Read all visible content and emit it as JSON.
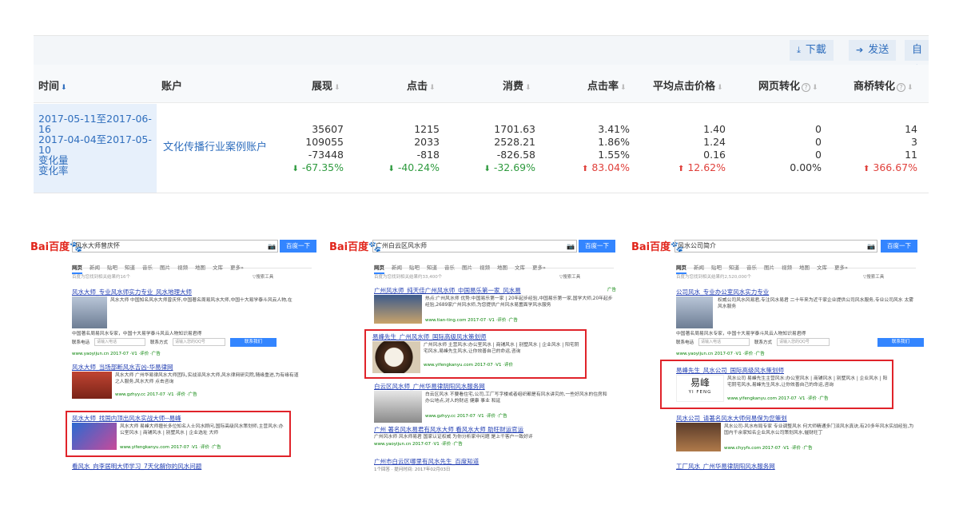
{
  "toolbar": {
    "download_label": "下載",
    "send_label": "发送",
    "extra_label": "自定"
  },
  "table": {
    "headers": {
      "time": "时间",
      "account": "账户",
      "impressions": "展现",
      "clicks": "点击",
      "cost": "消费",
      "ctr": "点击率",
      "avg_cpc": "平均点击价格",
      "page_conv": "网页转化",
      "bridge_conv": "商桥转化"
    },
    "left_rows": [
      "2017-05-11至2017-06-",
      "16",
      "2017-04-04至2017-05-",
      "10",
      "变化量",
      "变化率"
    ],
    "account_name": "文化传播行业案例账户",
    "columns": {
      "impressions": {
        "v1": "35607",
        "v2": "109055",
        "delta": "-73448",
        "rate": "-67.35%",
        "dir": "down"
      },
      "clicks": {
        "v1": "1215",
        "v2": "2033",
        "delta": "-818",
        "rate": "-40.24%",
        "dir": "down"
      },
      "cost": {
        "v1": "1701.63",
        "v2": "2528.21",
        "delta": "-826.58",
        "rate": "-32.69%",
        "dir": "down"
      },
      "ctr": {
        "v1": "3.41%",
        "v2": "1.86%",
        "delta": "1.55%",
        "rate": "83.04%",
        "dir": "up"
      },
      "avg_cpc": {
        "v1": "1.40",
        "v2": "1.24",
        "delta": "0.16",
        "rate": "12.62%",
        "dir": "up"
      },
      "page_conv": {
        "v1": "0",
        "v2": "0",
        "delta": "0",
        "rate": "0.00%",
        "dir": "none"
      },
      "bridge_conv": {
        "v1": "14",
        "v2": "3",
        "delta": "11",
        "rate": "366.67%",
        "dir": "up"
      }
    }
  },
  "baidu": {
    "logo": "Bai百度",
    "search_button": "百度一下",
    "tabs": [
      "网页",
      "新闻",
      "贴吧",
      "知道",
      "音乐",
      "图片",
      "视频",
      "地图",
      "文库",
      "更多»"
    ],
    "tool_label": "▽搜索工具",
    "ad_label": "广告",
    "shots": [
      {
        "query": "风水大师曾庆怀",
        "info": "百度为您找到相关结果约16个",
        "r1_title": "风水大师_专业风水师实力专业_风水地理大师",
        "r1_body": "风水大师 中国知名风水大师曾庆怀,中国著名周易风水大师,中国十大易学泰斗风云人物,在",
        "r1_contact": "中国著名周易风水专家，中国十大易学泰斗风云人物知识易君得",
        "r1_phone_label": "联系电话",
        "r1_phone_ph": "请输入电话",
        "r1_method_label": "联系方式",
        "r1_method_ph": "请输入您的QQ号",
        "r1_button": "联系我们",
        "r1_url": "www.yaoyijun.cn 2017-07 ·V1 ·评价 ·广告",
        "r2_title": "风水大师_当场部断风水吉凶-华易律网",
        "r2_body": "风水大师 广州华易律风水大师团队,实战派风水大师,风水律网研究院,随缘重进,为有缘有道之人服务,风水大师 点击咨询",
        "r2_url": "www.gzhyy.cc 2017-07 ·V1 ·评价 ·广告",
        "r3_title": "风水大师_找国内顶出风水实战大师--易峰",
        "r3_body": "风水大师 易峰大师擅长多位知名人士风水顾问,国际高级风水策划师,主营风水:办公室风水 | 商铺风水 | 别墅风水 | 企业选址 大师",
        "r3_url": "www.yifengkanyu.com 2017-07 ·V1 ·评价 ·广告",
        "r4_title": "看风水_向李居明大师学习_7天化解你的风水问题"
      },
      {
        "query": "广州白云区风水师",
        "info": "百度为您找到相关结果约33,400个",
        "r1_title": "广州风水师_纯天佳广州风水师_中国易乐第一家_风水易",
        "r1_body": "热点:广州风水师 优势:中国易乐第一家 | 20年起步经验,中国易乐第一家,国学大师,20年起步经验,2689家广州风水师,为您提供广州风水易置面学风水服务",
        "r1_url": "www.tian-ting.com 2017-07 ·V1 ·评价 ·广告",
        "r2_title": "易峰先生_广州风水师_国际高级风水策划师",
        "r2_body": "广州风水师 主营风水:办公室风水 | 商铺风水 | 别墅风水 | 企业风水 | 阳宅阴宅风水,易峰先生风水,让你效善自己的命运,咨询",
        "r2_url": "www.yifengkanyu.com 2017-07 ·V1 ·评价",
        "r3_title": "白云区风水师_广州华易律阴阳风水服务网",
        "r3_body": "白云区风水 不要看住宅,公司,工厂写字楼或者组织都是有风水讲究的,一些好风水的住房和办公地点,对人的财运 健康 事业 和延",
        "r3_url": "www.gzhyy.cc 2017-07 ·V1 ·评价 ·广告",
        "r4_title": "广州 著名风水易君有风水大师 看风水大师 助旺财运官运",
        "r4_body": "广州风水师 风水师易君 国家认证权威 为你分析家中问题 是上千客户一致好评",
        "r4_url": "www.yaoyijun.cn 2017-07 ·V1 ·评价 ·广告",
        "r5_title": "广州市白云区哪里有风水先生_百度知道",
        "r5_url": "1个回答 · 提问时间: 2017年02月03日"
      },
      {
        "query": "风水公司简介",
        "info": "百度为您找到相关结果约2,520,000个",
        "r1_title": "公司风水_专业办公室风水实力专业",
        "r1_body": "权威公司风水风易君,专注风水易君 二十年来为近千家企业提供公司风水服务,专业公司风水 太雾风水服务",
        "r1_contact": "中国著名周易风水专家，中国十大易学泰斗风云人物知识易君得",
        "r1_phone_label": "联系电话",
        "r1_phone_ph": "请输入电话",
        "r1_method_label": "联系方式",
        "r1_method_ph": "请输入您的QQ号",
        "r1_button": "联系我们",
        "r1_url": "www.yaoyijun.cn 2017-07 ·V1 ·评价 ·广告",
        "r2_title": "易峰先生_风水公司_国际高级风水策划师",
        "r2_body": "风水公司 易峰先生主营风水:办公室风水 | 商铺风水 | 别墅风水 | 企业风水 | 阳宅阴宅风水,易峰先生风水,让你效善自己的命运,咨询",
        "r2_logo": "易峰",
        "r2_logo_en": "YI FENG",
        "r2_url": "www.yifengkanyu.com 2017-07 ·V1 ·评价 ·广告",
        "r3_title": "风水公司_请著名风水大师何易保为您策划",
        "r3_body": "风水公司-风水布局专家 专业调整风水 何大师精通多门派风水真诀,有20多年风水实战经验,为国内千余家知名企业风水公司策划风水,催财旺丁",
        "r3_url": "www.chyyfs.com 2017-07 ·V1 ·评价 ·广告",
        "r4_title": "工厂风水_广州华易律阴阳风水服务网"
      }
    ]
  },
  "colors": {
    "link": "#2f6ebd",
    "down": "#2e9a3e",
    "up": "#e0413c",
    "highlight": "#e0232a",
    "baidu_blue": "#3385ff",
    "baidu_red": "#e1251b"
  }
}
